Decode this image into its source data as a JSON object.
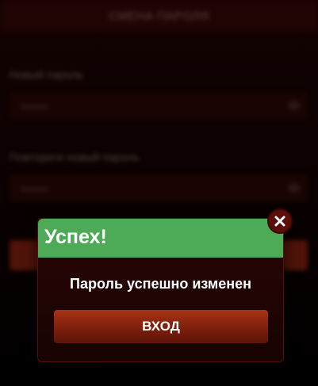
{
  "background": {
    "title": "СМЕНА ПАРОЛЯ",
    "new_password_label": "Новый пароль",
    "new_password_value": "••••••",
    "repeat_password_label": "Повторите новый пароль",
    "repeat_password_value": "••••••"
  },
  "modal": {
    "title": "Успех!",
    "message": "Пароль успешно изменен",
    "button_label": "ВХОД",
    "header_color": "#4daa57",
    "button_color": "#8f2a10"
  },
  "icons": {
    "close": "close-icon",
    "eye": "eye-icon"
  }
}
